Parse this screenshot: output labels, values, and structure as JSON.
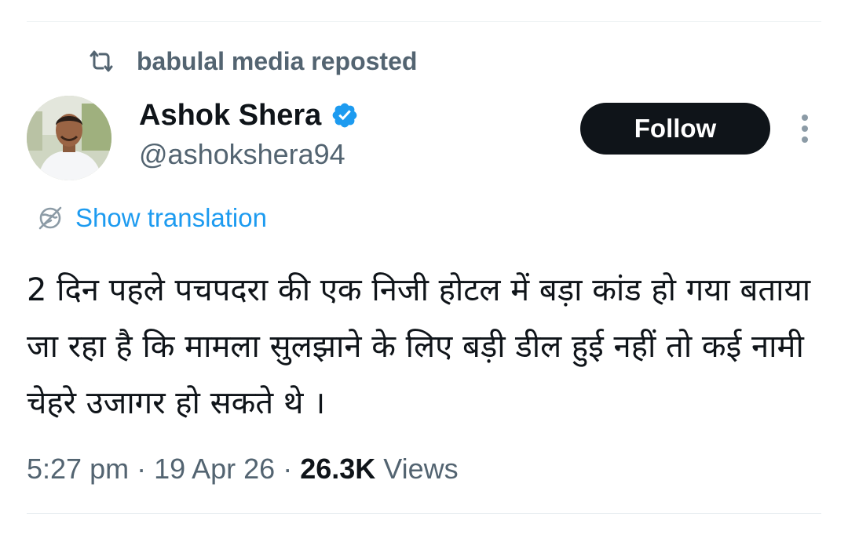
{
  "repost": {
    "icon": "repost-icon",
    "text": "babulal media reposted"
  },
  "author": {
    "avatar": "avatar",
    "display_name": "Ashok Shera",
    "verified": true,
    "verified_color": "#1d9bf0",
    "handle": "@ashokshera94"
  },
  "actions": {
    "follow_label": "Follow",
    "more_icon": "more-vertical-icon"
  },
  "translation": {
    "icon": "globe-icon",
    "label": "Show translation"
  },
  "tweet": {
    "text": "2 दिन पहले पचपदरा की एक निजी होटल में बड़ा कांड हो गया बताया जा रहा है कि मामला सुलझाने के लिए बड़ी डील हुई नहीं तो कई नामी चेहरे उजागर हो सकते थे ।"
  },
  "meta": {
    "time": "5:27 pm",
    "separator": "·",
    "date": "19 Apr 26",
    "views_count": "26.3K",
    "views_label": "Views"
  },
  "colors": {
    "accent": "#1d9bf0",
    "secondary_text": "#536471",
    "primary_text": "#0f1419",
    "button_bg": "#0f1419"
  }
}
